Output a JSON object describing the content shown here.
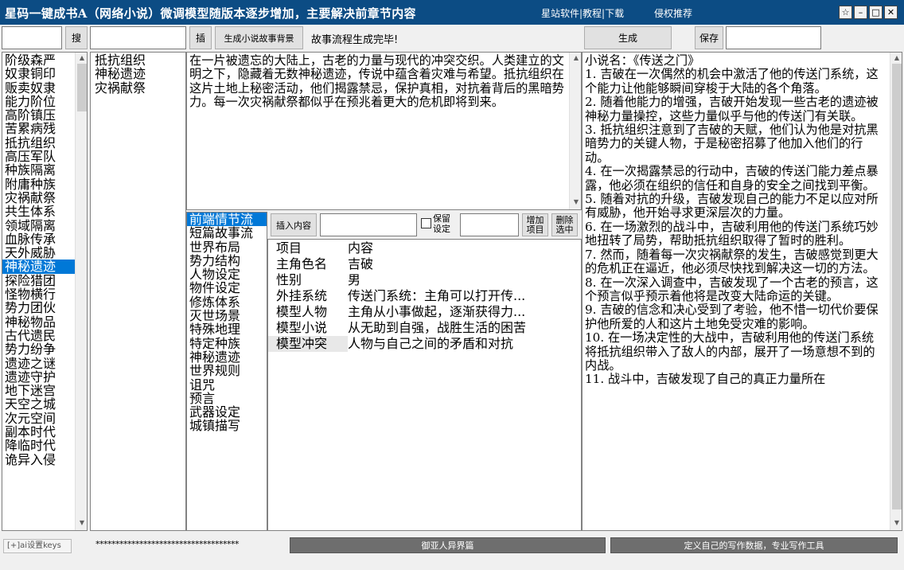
{
  "titlebar": {
    "title": "星码一键成书A（网络小说）微调模型随版本逐步增加，主要解决前章节内容",
    "links": "星站软件|教程|下载",
    "recommend": "侵权推荐",
    "win_buttons": [
      "☆",
      "–",
      "□",
      "✕"
    ]
  },
  "toolbar": {
    "search_value": "",
    "search_button": "搜",
    "insert_field_value": "",
    "insert_button": "插",
    "gen_background_button": "生成小说故事背景",
    "status_text": "故事流程生成完毕!",
    "generate_button": "生成",
    "save_button": "保存",
    "save_field_value": ""
  },
  "genre_list": [
    "阶级森严",
    "奴隶铜印",
    "贩卖奴隶",
    "能力阶位",
    "高阶镇压",
    "苦累病残",
    "抵抗组织",
    "高压军队",
    "种族隔离",
    "附庸种族",
    "灾祸献祭",
    "共生体系",
    "领域隔离",
    "血脉传承",
    "天外威胁",
    "神秘遗迹",
    "探险猎团",
    "怪物横行",
    "势力团伙",
    "神秘物品",
    "古代遗民",
    "势力纷争",
    "遗迹之谜",
    "遗迹守护",
    "地下迷宫",
    "天空之城",
    "次元空间",
    "副本时代",
    "降临时代",
    "诡异入侵"
  ],
  "genre_selected_index": 15,
  "selected_tags": [
    "抵抗组织",
    "神秘遗迹",
    "灾祸献祭"
  ],
  "story_background": "在一片被遗忘的大陆上，古老的力量与现代的冲突交织。人类建立的文明之下，隐藏着无数神秘遗迹，传说中蕴含着灾难与希望。抵抗组织在这片土地上秘密活动，他们揭露禁忌，保护真相，对抗着背后的黑暗势力。每一次灾祸献祭都似乎在预兆着更大的危机即将到来。",
  "category_list": [
    "前端情节流",
    "短篇故事流",
    "世界布局",
    "势力结构",
    "人物设定",
    "物件设定",
    "修炼体系",
    "灭世场景",
    "特殊地理",
    "特定种族",
    "神秘遗迹",
    "世界规则",
    "诅咒",
    "预言",
    "武器设定",
    "城镇描写"
  ],
  "category_selected_index": 0,
  "prop_toolbar": {
    "insert_content_button": "插入内容",
    "insert_content_value": "",
    "keep_setting_label": "保留设定",
    "keep_setting_checked": false,
    "extra_value": "",
    "add_item_button": "增加项目",
    "delete_selected_button": "删除选中"
  },
  "prop_table": {
    "header": {
      "key": "项目",
      "value": "内容"
    },
    "rows": [
      {
        "key": "主角色名",
        "value": "吉破"
      },
      {
        "key": "性别",
        "value": "男"
      },
      {
        "key": "外挂系统",
        "value": "传送门系统：主角可以打开传..."
      },
      {
        "key": "模型人物",
        "value": "主角从小事做起，逐渐获得力..."
      },
      {
        "key": "模型小说",
        "value": "从无助到自强，战胜生活的困苦"
      },
      {
        "key": "模型冲突",
        "value": "人物与自己之间的矛盾和对抗"
      }
    ],
    "selected_index": 5
  },
  "outline": {
    "title": "小说名：《传送之门》",
    "items": [
      "1. 吉破在一次偶然的机会中激活了他的传送门系统，这个能力让他能够瞬间穿梭于大陆的各个角落。",
      "2. 随着他能力的增强，吉破开始发现一些古老的遗迹被神秘力量操控，这些力量似乎与他的传送门有关联。",
      "3. 抵抗组织注意到了吉破的天赋，他们认为他是对抗黑暗势力的关键人物，于是秘密招募了他加入他们的行动。",
      "4. 在一次揭露禁忌的行动中，吉破的传送门能力差点暴露，他必须在组织的信任和自身的安全之间找到平衡。",
      "5. 随着对抗的升级，吉破发现自己的能力不足以应对所有威胁，他开始寻求更深层次的力量。",
      "6. 在一场激烈的战斗中，吉破利用他的传送门系统巧妙地扭转了局势，帮助抵抗组织取得了暂时的胜利。",
      "7. 然而，随着每一次灾祸献祭的发生，吉破感觉到更大的危机正在逼近，他必须尽快找到解决这一切的方法。",
      "8. 在一次深入调查中，吉破发现了一个古老的预言，这个预言似乎预示着他将是改变大陆命运的关键。",
      "9. 吉破的信念和决心受到了考验，他不惜一切代价要保护他所爱的人和这片土地免受灾难的影响。",
      "10. 在一场决定性的大战中，吉破利用他的传送门系统将抵抗组织带入了敌人的内部，展开了一场意想不到的内战。",
      "11. 战斗中，吉破发现了自己的真正力量所在"
    ]
  },
  "statusbar": {
    "ai_settings_label": "[+]ai设置keys",
    "masked_key": "************************************",
    "btn_genre": "御亚人异界篇",
    "btn_custom": "定义自己的写作数据，专业写作工具"
  }
}
